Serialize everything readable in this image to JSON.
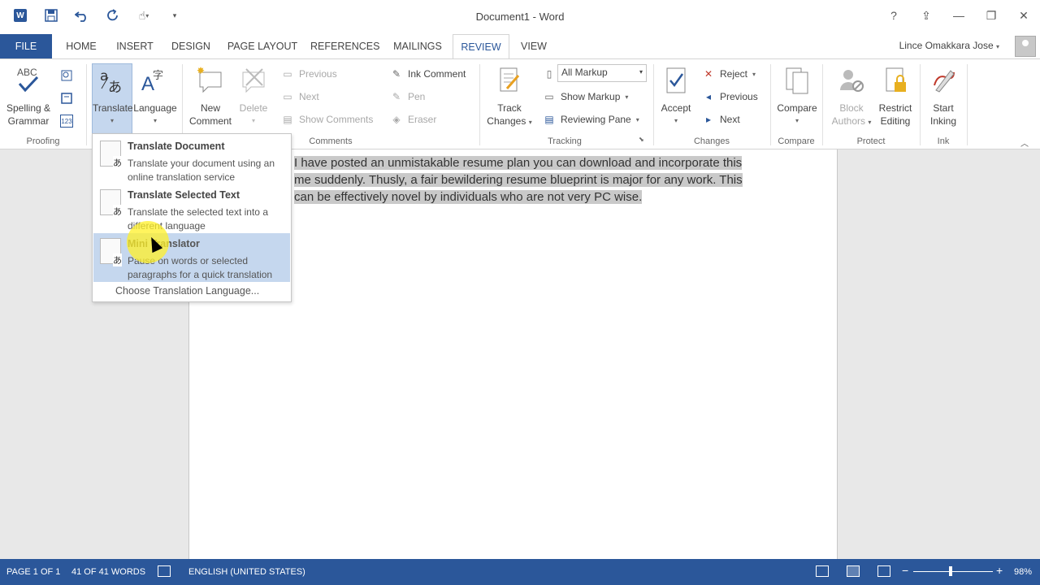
{
  "window": {
    "title": "Document1 - Word",
    "help": "?",
    "ribbon_display": "⇪",
    "minimize": "—",
    "restore": "❐",
    "close": "✕"
  },
  "qat": {
    "app_icon": "W",
    "save_icon": "save-icon",
    "undo_icon": "undo-icon",
    "redo_icon": "redo-icon",
    "touch_icon": "touch-mode-icon",
    "customize_icon": "customize-icon"
  },
  "tabs": [
    "FILE",
    "HOME",
    "INSERT",
    "DESIGN",
    "PAGE LAYOUT",
    "REFERENCES",
    "MAILINGS",
    "REVIEW",
    "VIEW"
  ],
  "active_tab": "REVIEW",
  "user": {
    "name": "Lince Omakkara Jose"
  },
  "ribbon": {
    "proofing": {
      "label": "Proofing",
      "spelling_line1": "Spelling &",
      "spelling_line2": "Grammar",
      "abc": "ABC",
      "count": "123"
    },
    "language": {
      "translate": "Translate",
      "language": "Language"
    },
    "comments": {
      "label": "Comments",
      "new_line1": "New",
      "new_line2": "Comment",
      "delete": "Delete",
      "previous": "Previous",
      "next": "Next",
      "show_comments": "Show Comments",
      "ink_comment": "Ink Comment",
      "pen": "Pen",
      "eraser": "Eraser"
    },
    "tracking": {
      "label": "Tracking",
      "track_line1": "Track",
      "track_line2": "Changes",
      "markup_value": "All Markup",
      "show_markup": "Show Markup",
      "reviewing_pane": "Reviewing Pane"
    },
    "changes": {
      "label": "Changes",
      "accept": "Accept",
      "reject": "Reject",
      "previous": "Previous",
      "next": "Next"
    },
    "compare": {
      "label": "Compare",
      "compare": "Compare"
    },
    "protect": {
      "label": "Protect",
      "block_line1": "Block",
      "block_line2": "Authors",
      "restrict_line1": "Restrict",
      "restrict_line2": "Editing"
    },
    "ink": {
      "label": "Ink",
      "start_line1": "Start",
      "start_line2": "Inking"
    }
  },
  "translate_menu": {
    "items": [
      {
        "title": "Translate Document",
        "desc": "Translate your document using an online translation service"
      },
      {
        "title": "Translate Selected Text",
        "desc": "Translate the selected text into a different language"
      },
      {
        "title": "Mini Translator",
        "desc": "Pause on words or selected paragraphs for a quick translation"
      }
    ],
    "choose": "Choose Translation Language..."
  },
  "document": {
    "line1": "I have posted an unmistakable resume plan you can download and incorporate this",
    "line2": "me suddenly. Thusly, a fair bewildering resume blueprint is major for any work. This",
    "line3": "can be effectively novel by individuals who are not very PC wise."
  },
  "statusbar": {
    "page": "PAGE 1 OF 1",
    "words": "41 OF 41 WORDS",
    "language": "ENGLISH (UNITED STATES)",
    "zoom_minus": "−",
    "zoom_plus": "+",
    "zoom": "98%",
    "zoom_level_fraction": 0.45
  },
  "colors": {
    "brand": "#2b579a",
    "highlight": "#c5d7ee",
    "selection": "#c9c9c9"
  }
}
